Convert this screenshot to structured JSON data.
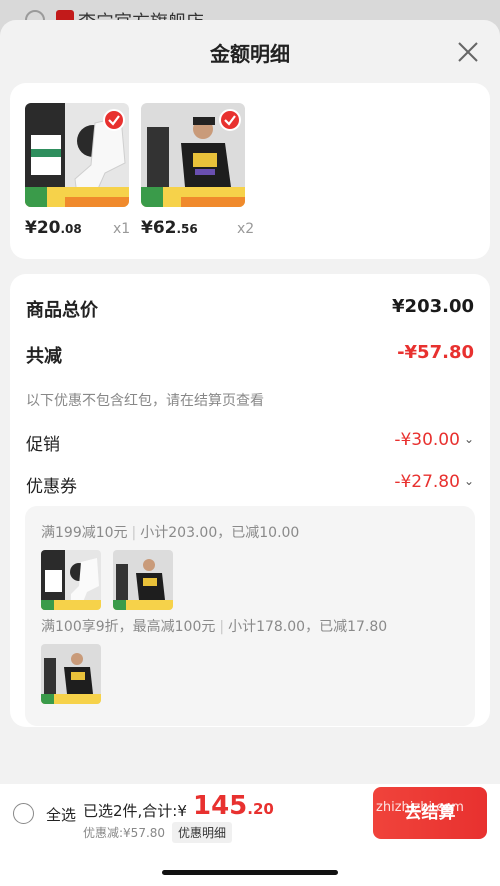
{
  "background": {
    "shop_name": "李宁官方旗舰店"
  },
  "sheet": {
    "title": "金额明细"
  },
  "products": [
    {
      "price_main": "¥20",
      "price_decimal": ".08",
      "qty": "x1",
      "sku": "basketball-socks"
    },
    {
      "price_main": "¥62",
      "price_decimal": ".56",
      "qty": "x2",
      "sku": "tshirt"
    }
  ],
  "summary": {
    "total_label": "商品总价",
    "total_value": "¥203.00",
    "reduce_label": "共减",
    "reduce_value": "-¥57.80",
    "note": "以下优惠不包含红包，请在结算页查看",
    "promo_label": "促销",
    "promo_value": "-¥30.00",
    "coupon_label": "优惠券",
    "coupon_value": "-¥27.80"
  },
  "promotions": [
    {
      "rule": "满199减10元",
      "detail": "小计203.00，已减10.00"
    },
    {
      "rule": "满100享9折，最高减100元",
      "detail": "小计178.00，已减17.80"
    }
  ],
  "bottom_bar": {
    "select_all": "全选",
    "selected_info": "已选2件,合计:¥",
    "total_main": "145",
    "total_decimal": ".20",
    "discount": "优惠减:¥57.80",
    "detail_tag": "优惠明细",
    "checkout": "去结算"
  },
  "watermark": "zhizhizhi.com",
  "colors": {
    "accent": "#e8312f",
    "sheet_bg": "#f2f2f2"
  }
}
